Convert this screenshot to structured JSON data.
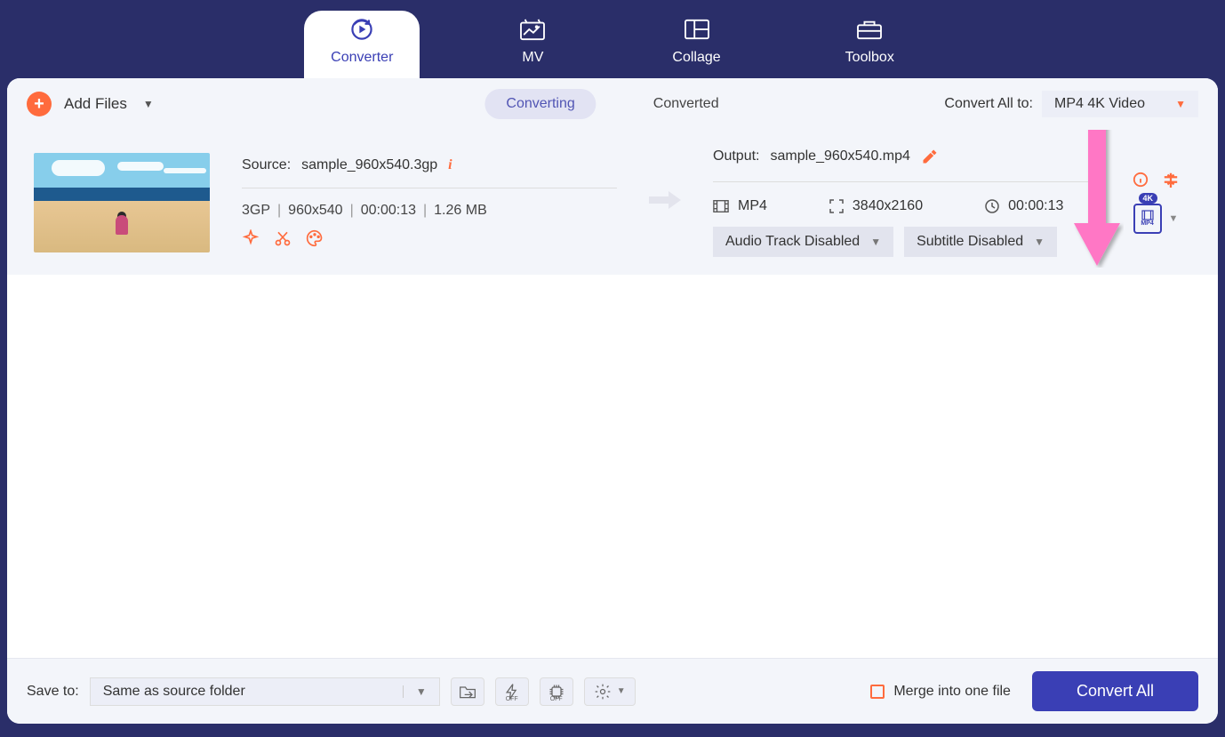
{
  "tabs": {
    "converter": "Converter",
    "mv": "MV",
    "collage": "Collage",
    "toolbox": "Toolbox"
  },
  "toolbar": {
    "addFiles": "Add Files",
    "converting": "Converting",
    "converted": "Converted",
    "convertAllTo": "Convert All to:",
    "formatSelected": "MP4 4K Video"
  },
  "file": {
    "sourceLabel": "Source:",
    "sourceFile": "sample_960x540.3gp",
    "sourceFormat": "3GP",
    "sourceRes": "960x540",
    "sourceDuration": "00:00:13",
    "sourceSize": "1.26 MB",
    "outputLabel": "Output:",
    "outputFile": "sample_960x540.mp4",
    "outputFormat": "MP4",
    "outputRes": "3840x2160",
    "outputDuration": "00:00:13",
    "audioTrack": "Audio Track Disabled",
    "subtitle": "Subtitle Disabled",
    "badge4k": "4K",
    "badgeFormat": "MP4"
  },
  "footer": {
    "saveTo": "Save to:",
    "folder": "Same as source folder",
    "merge": "Merge into one file",
    "convertAll": "Convert All"
  }
}
